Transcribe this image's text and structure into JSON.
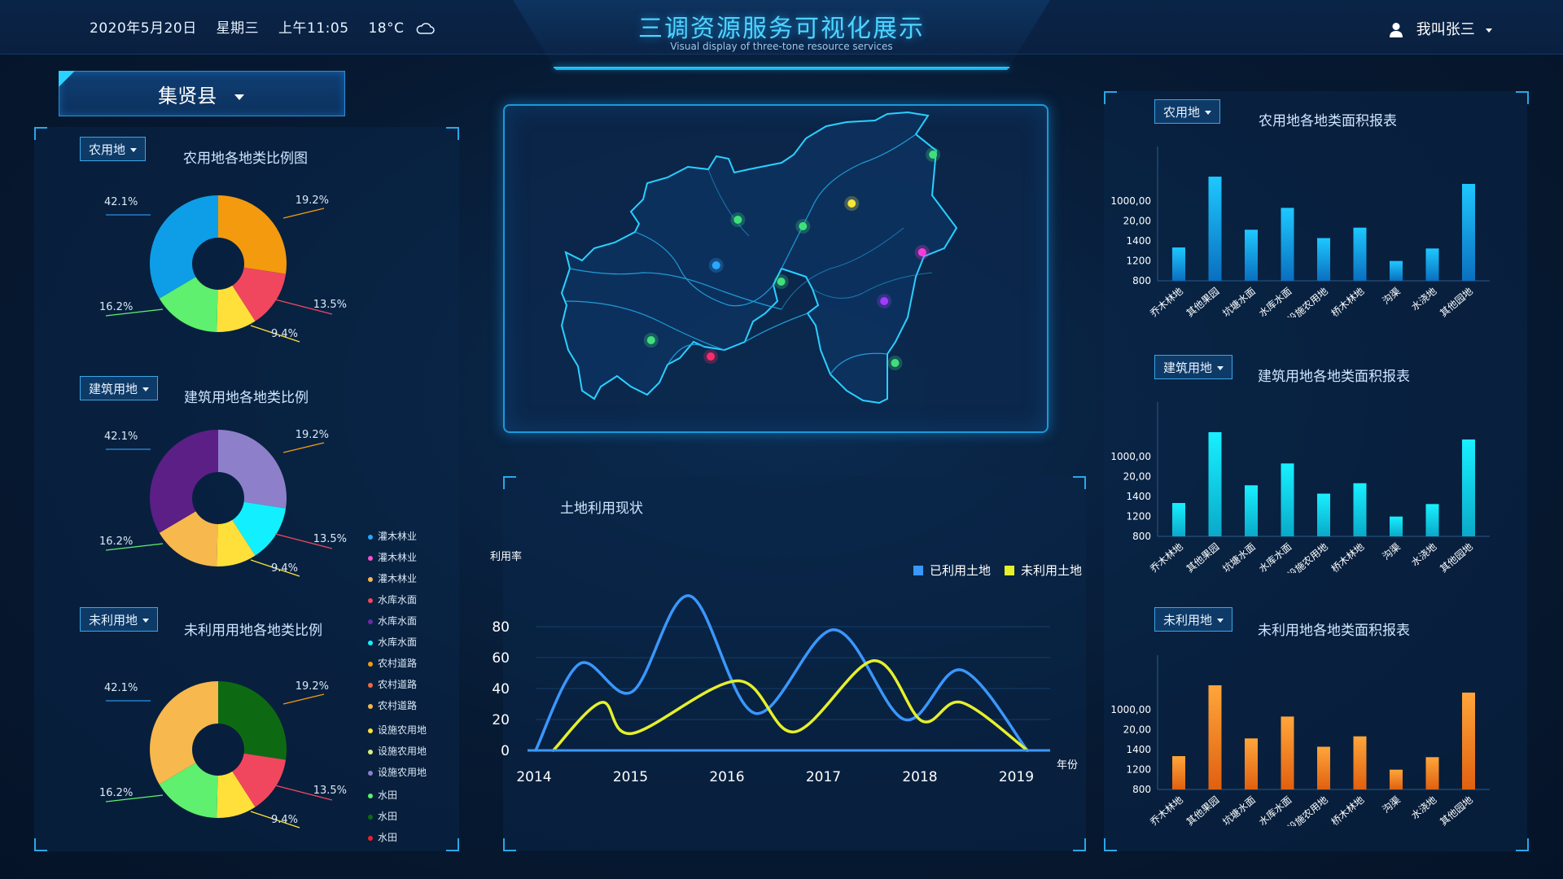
{
  "header": {
    "date": "2020年5月20日",
    "weekday": "星期三",
    "time": "上午11:05",
    "temp": "18°C",
    "weather_icon": "cloud-icon",
    "title_cn": "三调资源服务可视化展示",
    "title_en": "Visual display of three-tone resource services",
    "user": "我叫张三"
  },
  "county": {
    "label": "集贤县"
  },
  "left": {
    "sections": [
      {
        "dropdown": "农用地",
        "title": "农用地各地类比例图",
        "labels": [
          "42.1%",
          "19.2%",
          "16.2%",
          "13.5%",
          "9.4%"
        ],
        "slices": [
          {
            "value": 27.4,
            "color": "#f39a0e"
          },
          {
            "value": 13.5,
            "color": "#f0475e"
          },
          {
            "value": 9.4,
            "color": "#ffe03a"
          },
          {
            "value": 16.2,
            "color": "#5ef06e"
          },
          {
            "value": 33.5,
            "color": "#0e9ee8"
          }
        ]
      },
      {
        "dropdown": "建筑用地",
        "title": "建筑用地各地类比例",
        "labels": [
          "42.1%",
          "19.2%",
          "16.2%",
          "13.5%",
          "9.4%"
        ],
        "slices": [
          {
            "value": 27.4,
            "color": "#8d7fc9"
          },
          {
            "value": 13.5,
            "color": "#12f0ff"
          },
          {
            "value": 9.4,
            "color": "#ffe03a"
          },
          {
            "value": 16.2,
            "color": "#f7b84e"
          },
          {
            "value": 33.5,
            "color": "#5b1f86"
          }
        ]
      },
      {
        "dropdown": "未利用地",
        "title": "未利用用地各地类比例",
        "labels": [
          "42.1%",
          "19.2%",
          "16.2%",
          "13.5%",
          "9.4%"
        ],
        "slices": [
          {
            "value": 27.4,
            "color": "#0e6a12"
          },
          {
            "value": 13.5,
            "color": "#f0475e"
          },
          {
            "value": 9.4,
            "color": "#ffe03a"
          },
          {
            "value": 16.2,
            "color": "#5ef06e"
          },
          {
            "value": 33.5,
            "color": "#f7b84e"
          }
        ]
      }
    ],
    "legend": [
      {
        "label": "灌木林业",
        "color": "#2aa7ff"
      },
      {
        "label": "灌木林业",
        "color": "#ff4fd0"
      },
      {
        "label": "灌木林业",
        "color": "#f7b84e"
      },
      {
        "label": "水库水面",
        "color": "#f0475e"
      },
      {
        "label": "水库水面",
        "color": "#6a2aa6"
      },
      {
        "label": "水库水面",
        "color": "#12f0ff"
      },
      {
        "label": "农村道路",
        "color": "#f39a0e"
      },
      {
        "label": "农村道路",
        "color": "#f06a3a"
      },
      {
        "label": "农村道路",
        "color": "#f7b84e"
      },
      {
        "label": "设施农用地",
        "color": "#ffe03a"
      },
      {
        "label": "设施农用地",
        "color": "#d8f07a"
      },
      {
        "label": "设施农用地",
        "color": "#8d7fc9"
      },
      {
        "label": "水田",
        "color": "#5ef06e"
      },
      {
        "label": "水田",
        "color": "#0e6a12"
      },
      {
        "label": "水田",
        "color": "#f0202e"
      }
    ]
  },
  "map": {
    "points": [
      {
        "color": "#3fe07a",
        "fx": 0.79,
        "fy": 0.15
      },
      {
        "color": "#f5e63a",
        "fx": 0.64,
        "fy": 0.3
      },
      {
        "color": "#3fe07a",
        "fx": 0.43,
        "fy": 0.35
      },
      {
        "color": "#3fe07a",
        "fx": 0.55,
        "fy": 0.37
      },
      {
        "color": "#2aa7ff",
        "fx": 0.39,
        "fy": 0.49
      },
      {
        "color": "#ff3adc",
        "fx": 0.77,
        "fy": 0.45
      },
      {
        "color": "#3fe07a",
        "fx": 0.51,
        "fy": 0.54
      },
      {
        "color": "#a43aff",
        "fx": 0.7,
        "fy": 0.6
      },
      {
        "color": "#3fe07a",
        "fx": 0.27,
        "fy": 0.72
      },
      {
        "color": "#ff2a6a",
        "fx": 0.38,
        "fy": 0.77
      },
      {
        "color": "#3fe07a",
        "fx": 0.72,
        "fy": 0.79
      }
    ]
  },
  "land_use": {
    "title": "土地利用现状",
    "chart_data": {
      "type": "line",
      "ylabel": "利用率",
      "xlabel": "年份",
      "x_ticks": [
        "2014",
        "2015",
        "2016",
        "2017",
        "2018",
        "2019"
      ],
      "y_ticks": [
        "0",
        "20",
        "40",
        "60",
        "80"
      ],
      "ylim": [
        0,
        100
      ],
      "series": [
        {
          "name": "已利用土地",
          "color": "#3a97ff",
          "x": [
            2014.0,
            2014.5,
            2015.1,
            2015.75,
            2016.5,
            2017.4,
            2018.2,
            2018.85,
            2019.6
          ],
          "values": [
            0,
            56,
            38,
            100,
            24,
            78,
            20,
            52,
            0
          ]
        },
        {
          "name": "未利用土地",
          "color": "#e6f02a",
          "x": [
            2014.2,
            2014.75,
            2015.1,
            2016.3,
            2016.95,
            2017.85,
            2018.4,
            2018.85,
            2019.6
          ],
          "values": [
            0,
            31,
            11,
            45,
            12,
            58,
            19,
            31,
            0
          ]
        }
      ]
    }
  },
  "right": {
    "sections": [
      {
        "dropdown": "农用地",
        "title": "农用地各地类面积报表",
        "color_top": "#1ec8ff",
        "color_bot": "#0a6fbf"
      },
      {
        "dropdown": "建筑用地",
        "title": "建筑用地各地类面积报表",
        "color_top": "#18f0ff",
        "color_bot": "#0aa9c9"
      },
      {
        "dropdown": "未利用地",
        "title": "未利用地各地类面积报表",
        "color_top": "#ffa63a",
        "color_bot": "#e06010"
      }
    ],
    "chart_data": {
      "type": "bar",
      "y_ticks": [
        "800",
        "1200",
        "1400",
        "20,00",
        "1000,00"
      ],
      "categories": [
        "乔木林地",
        "其他果园",
        "坑塘水面",
        "水库水面",
        "设施农用地",
        "桥木林地",
        "沟渠",
        "水浇地",
        "其他园地"
      ],
      "values": [
        32,
        100,
        49,
        70,
        41,
        51,
        19,
        31,
        93
      ]
    }
  }
}
